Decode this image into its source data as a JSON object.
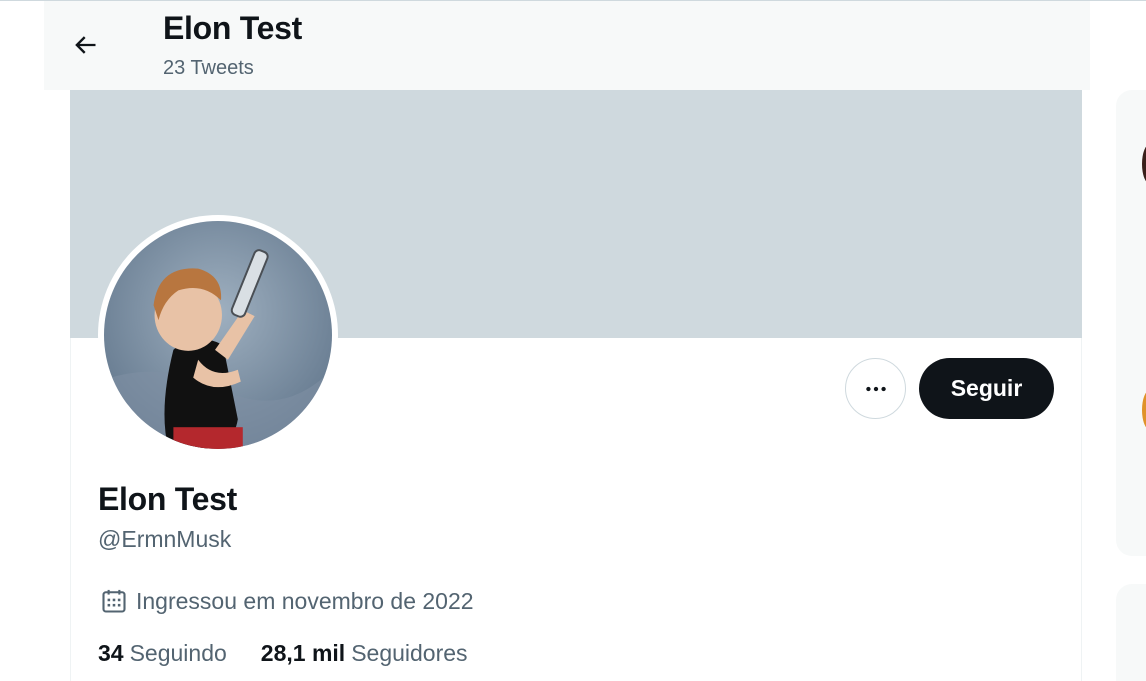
{
  "header": {
    "title": "Elon Test",
    "tweet_count": "23 Tweets"
  },
  "profile": {
    "name": "Elon Test",
    "handle": "@ErmnMusk",
    "joined": "Ingressou em novembro de 2022",
    "follow_label": "Seguir",
    "following": {
      "count": "34",
      "label": "Seguindo"
    },
    "followers": {
      "count": "28,1 mil",
      "label": "Seguidores"
    }
  },
  "colors": {
    "banner": "#cfd9de",
    "follow_button": "#0f1419",
    "secondary_text": "#536471"
  },
  "icons": {
    "back": "arrow-left-icon",
    "more": "more-horizontal-icon",
    "joined": "calendar-icon"
  }
}
